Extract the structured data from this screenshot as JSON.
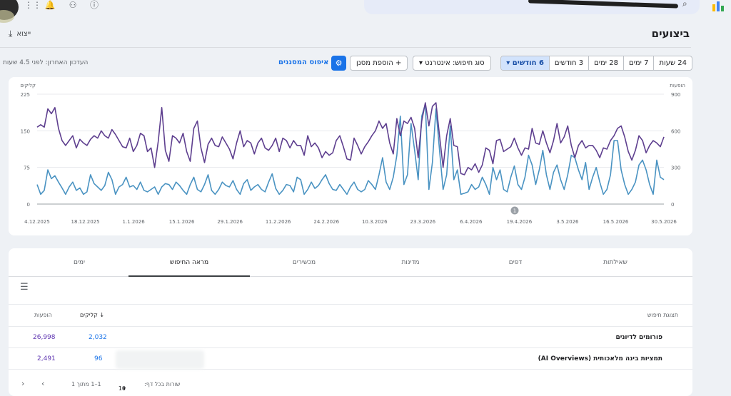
{
  "header": {
    "title": "ביצועים",
    "export_label": "ייצוא",
    "updated_text": "העדכון האחרון: לפני 4.5 שעות"
  },
  "filters": {
    "date_ranges": [
      "24 שעות",
      "7 ימים",
      "28 ימים",
      "3 חודשים",
      "6 חודשים"
    ],
    "active_range": "6 חודשים",
    "search_type": "סוג חיפוש: אינטרנט",
    "add_filter": "הוספת מסנן",
    "reset": "איפוס המסננים"
  },
  "colors": {
    "clicks": "#4a93c2",
    "impressions": "#5e3f8f",
    "accent": "#1a73e8"
  },
  "chart_data": {
    "type": "line",
    "left_axis_label": "קליקים",
    "right_axis_label": "הופעות",
    "left_ticks": [
      "225",
      "150",
      "75",
      "0"
    ],
    "right_ticks": [
      "900",
      "600",
      "300",
      "0"
    ],
    "ylim_left": [
      0,
      225
    ],
    "ylim_right": [
      0,
      900
    ],
    "x_tick_labels": [
      "4.12.2025",
      "18.12.2025",
      "1.1.2026",
      "15.1.2026",
      "29.1.2026",
      "11.2.2026",
      "24.2.2026",
      "10.3.2026",
      "23.3.2026",
      "6.4.2026",
      "19.4.2026",
      "3.5.2026",
      "16.5.2026",
      "30.5.2026"
    ],
    "annotation": "1",
    "series": [
      {
        "name": "קליקים",
        "axis": "left",
        "values": [
          40,
          20,
          28,
          70,
          52,
          58,
          45,
          33,
          20,
          35,
          45,
          28,
          33,
          20,
          25,
          60,
          42,
          35,
          28,
          38,
          65,
          50,
          20,
          35,
          40,
          55,
          35,
          38,
          30,
          45,
          28,
          25,
          30,
          35,
          20,
          35,
          42,
          40,
          30,
          45,
          38,
          28,
          20,
          40,
          55,
          30,
          25,
          40,
          60,
          28,
          20,
          30,
          45,
          38,
          35,
          48,
          30,
          20,
          42,
          50,
          28,
          35,
          40,
          30,
          25,
          45,
          62,
          32,
          20,
          28,
          40,
          38,
          25,
          55,
          50,
          20,
          30,
          45,
          32,
          38,
          50,
          60,
          42,
          30,
          28,
          40,
          30,
          20,
          35,
          45,
          30,
          25,
          30,
          48,
          40,
          30,
          60,
          95,
          45,
          30,
          55,
          100,
          180,
          40,
          60,
          165,
          110,
          50,
          180,
          205,
          30,
          85,
          195,
          110,
          30,
          60,
          160,
          50,
          70,
          20,
          22,
          25,
          40,
          30,
          35,
          55,
          40,
          20,
          75,
          50,
          70,
          30,
          25,
          55,
          78,
          40,
          30,
          55,
          100,
          80,
          40,
          70,
          110,
          60,
          30,
          65,
          80,
          50,
          30,
          60,
          100,
          95,
          70,
          50,
          85,
          30,
          55,
          75,
          45,
          20,
          30,
          60,
          130,
          130,
          70,
          40,
          20,
          30,
          45,
          80,
          90,
          70,
          40,
          20,
          90,
          55,
          50
        ]
      },
      {
        "name": "הופעות",
        "axis": "right",
        "values": [
          630,
          650,
          630,
          780,
          740,
          790,
          620,
          520,
          480,
          520,
          560,
          460,
          530,
          500,
          480,
          530,
          560,
          540,
          600,
          560,
          540,
          610,
          570,
          520,
          470,
          460,
          540,
          430,
          480,
          580,
          560,
          430,
          460,
          300,
          510,
          790,
          440,
          350,
          560,
          540,
          500,
          580,
          430,
          350,
          620,
          680,
          460,
          340,
          490,
          540,
          480,
          470,
          550,
          500,
          450,
          370,
          500,
          600,
          470,
          520,
          500,
          410,
          500,
          540,
          460,
          440,
          480,
          540,
          430,
          540,
          520,
          460,
          520,
          480,
          480,
          400,
          560,
          470,
          500,
          460,
          380,
          430,
          400,
          420,
          520,
          560,
          470,
          370,
          360,
          540,
          480,
          410,
          470,
          510,
          560,
          600,
          680,
          620,
          660,
          500,
          410,
          700,
          560,
          680,
          660,
          710,
          620,
          380,
          680,
          830,
          640,
          800,
          830,
          560,
          300,
          560,
          700,
          480,
          470,
          250,
          240,
          300,
          280,
          330,
          260,
          320,
          460,
          440,
          330,
          520,
          530,
          430,
          450,
          470,
          540,
          460,
          400,
          460,
          450,
          620,
          500,
          490,
          600,
          500,
          420,
          520,
          660,
          500,
          550,
          640,
          480,
          380,
          480,
          520,
          460,
          480,
          480,
          440,
          380,
          460,
          450,
          520,
          560,
          620,
          640,
          550,
          430,
          360,
          440,
          560,
          520,
          420,
          480,
          520,
          500,
          470,
          550
        ]
      }
    ]
  },
  "tabs": {
    "queries": "שאילתות",
    "pages": "דפים",
    "countries": "מדינות",
    "devices": "מכשירים",
    "search_appearance": "מראה החיפוש",
    "days": "ימים"
  },
  "table": {
    "col_search": "תצוגת חיפוש",
    "col_clicks": "קליקים",
    "col_impressions": "הופעות",
    "rows": [
      {
        "label": "פורומים לדיונים",
        "clicks": "2,032",
        "impressions": "26,998"
      },
      {
        "label": "תמציות בינה מלאכותית (AI Overviews)",
        "clicks": "96",
        "impressions": "2,491"
      }
    ]
  },
  "pager": {
    "rows_label": "שורות בכל דף:",
    "rows_value": "10",
    "range": "1–1 מתוך 1"
  }
}
